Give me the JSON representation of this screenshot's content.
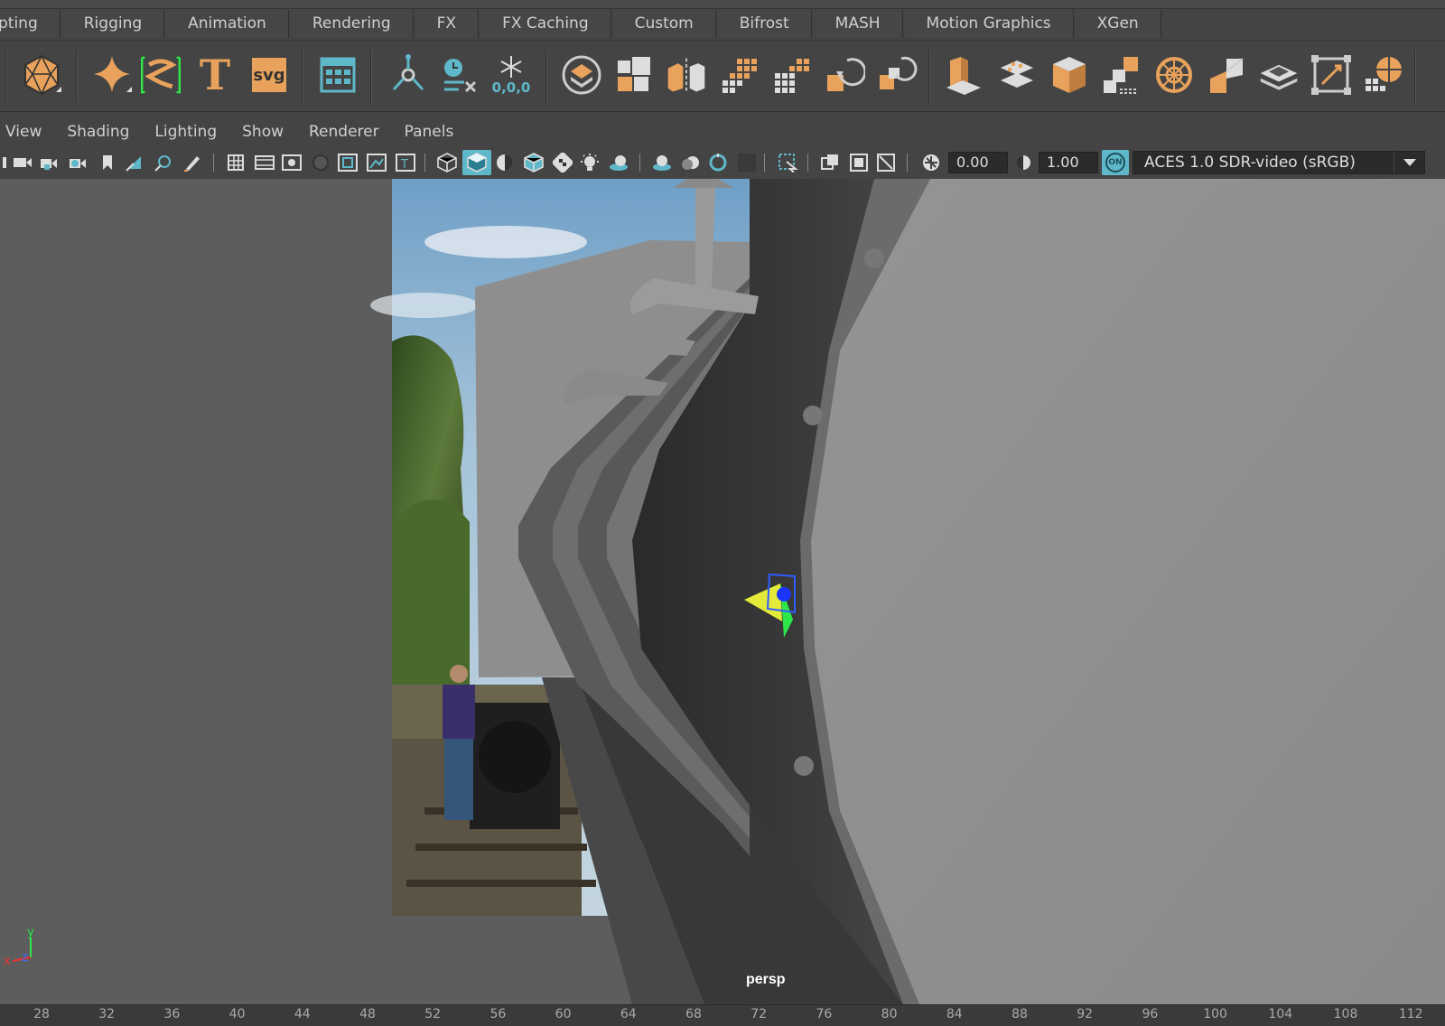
{
  "shelf_tabs": [
    "pting",
    "Rigging",
    "Animation",
    "Rendering",
    "FX",
    "FX Caching",
    "Custom",
    "Bifrost",
    "MASH",
    "Motion Graphics",
    "XGen"
  ],
  "shelf": {
    "icons": [
      "polygon-sphere-icon",
      "sweep-mesh-icon",
      "lattice-icon",
      "type-text-icon",
      "svg-icon",
      "panel-grid-icon",
      "mash-network-icon",
      "time-clear-icon",
      "freeze-transform-icon",
      "extract-layer-icon",
      "combine-icon",
      "separate-icon",
      "grid-cells-icon",
      "grid-cells-alt-icon",
      "cluster-icon",
      "rotate-instance-icon",
      "rotate-instance-alt-icon",
      "column-icon",
      "scatter-planes-icon",
      "cube-icon",
      "split-cubes-icon",
      "radial-icon",
      "cube-corner-icon",
      "layers-icon",
      "bounding-box-icon",
      "sphere-grid-icon"
    ],
    "svg_label": "svg",
    "freeze_label": "0,0,0",
    "type_label": "T"
  },
  "panel_menu": [
    "View",
    "Shading",
    "Lighting",
    "Show",
    "Renderer",
    "Panels"
  ],
  "panel_toolbar": {
    "exposure_value": "0.00",
    "gamma_value": "1.00",
    "color_mgmt_label": "ON",
    "view_transform": "ACES 1.0 SDR-video (sRGB)"
  },
  "viewport": {
    "camera_name": "persp",
    "axis_x": "x",
    "axis_y": "y",
    "axis_z": "z"
  },
  "timeline": {
    "ticks": [
      "28",
      "32",
      "36",
      "40",
      "44",
      "48",
      "52",
      "56",
      "60",
      "64",
      "68",
      "72",
      "76",
      "80",
      "84",
      "88",
      "92",
      "96",
      "100",
      "104",
      "108",
      "112"
    ]
  },
  "colors": {
    "accent_orange": "#e8a25b",
    "accent_teal": "#5fb8c9",
    "selection_green": "#2ee84a",
    "bg": "#444444"
  }
}
